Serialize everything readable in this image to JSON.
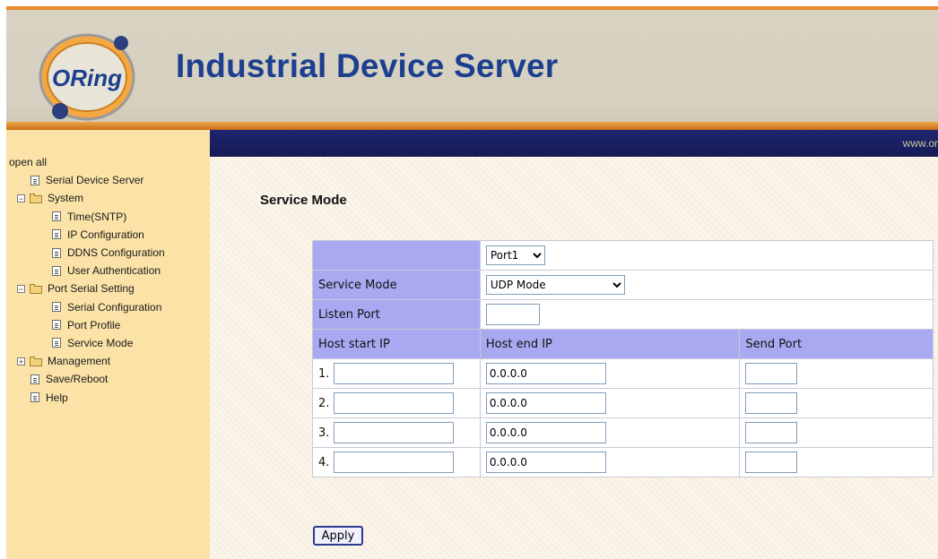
{
  "header": {
    "logo_text": "ORing",
    "title": "Industrial Device Server",
    "colors": {
      "title": "#1c3f8f",
      "accent": "#e8892a",
      "navbar": "#1a1f63"
    }
  },
  "sidebar": {
    "open_all": "open all",
    "items": [
      {
        "label": "Serial Device Server",
        "icon": "page-icon"
      },
      {
        "label": "System",
        "icon": "folder-icon",
        "expander": "⊟"
      },
      {
        "label": "Time(SNTP)",
        "icon": "page-icon"
      },
      {
        "label": "IP Configuration",
        "icon": "page-icon"
      },
      {
        "label": "DDNS Configuration",
        "icon": "page-icon"
      },
      {
        "label": "User Authentication",
        "icon": "page-icon"
      },
      {
        "label": "Port Serial Setting",
        "icon": "folder-icon",
        "expander": "⊟"
      },
      {
        "label": "Serial Configuration",
        "icon": "page-icon"
      },
      {
        "label": "Port Profile",
        "icon": "page-icon"
      },
      {
        "label": "Service Mode",
        "icon": "page-icon"
      },
      {
        "label": "Management",
        "icon": "folder-icon",
        "expander": "⊞"
      },
      {
        "label": "Save/Reboot",
        "icon": "page-icon"
      },
      {
        "label": "Help",
        "icon": "page-icon"
      }
    ]
  },
  "navbar": {
    "url_text": "www.or"
  },
  "main": {
    "page_title": "Service Mode",
    "port_select": "Port1",
    "service_mode_label": "Service Mode",
    "service_mode_value": "UDP Mode",
    "listen_port_label": "Listen Port",
    "listen_port_value": "",
    "columns": [
      "Host start IP",
      "Host end IP",
      "Send Port"
    ],
    "rows": [
      {
        "num": "1.",
        "start_ip": "",
        "end_ip": "0.0.0.0",
        "send_port": ""
      },
      {
        "num": "2.",
        "start_ip": "",
        "end_ip": "0.0.0.0",
        "send_port": ""
      },
      {
        "num": "3.",
        "start_ip": "",
        "end_ip": "0.0.0.0",
        "send_port": ""
      },
      {
        "num": "4.",
        "start_ip": "",
        "end_ip": "0.0.0.0",
        "send_port": ""
      }
    ],
    "apply_label": "Apply"
  }
}
